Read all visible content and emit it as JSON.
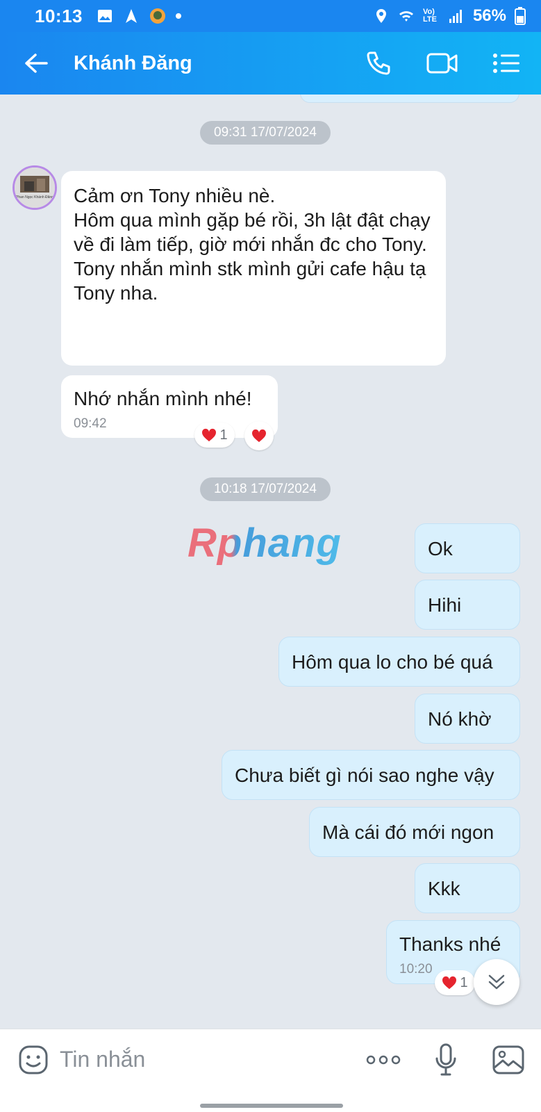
{
  "status_bar": {
    "time": "10:13",
    "battery": "56%",
    "lte_label": "Vo) LTE"
  },
  "header": {
    "title": "Khánh Đăng",
    "accent_color": "#1a86f0"
  },
  "chat": {
    "groups": [
      {
        "date_label": "09:31 17/07/2024",
        "sender": "contact",
        "avatar_caption": "Phan Ngọc Khánh Đăng",
        "messages": [
          {
            "text": "Cảm ơn Tony nhiều nè.\nHôm qua mình gặp bé rồi, 3h lật đật chạy về đi làm tiếp, giờ mới nhắn đc cho Tony.\nTony nhắn mình stk mình gửi cafe hậu tạ Tony nha.",
            "time": ""
          },
          {
            "text": "Nhớ nhắn mình nhé!",
            "time": "09:42",
            "reaction_count": "1"
          }
        ]
      },
      {
        "date_label": "10:18 17/07/2024",
        "sender": "me",
        "messages": [
          {
            "text": "Ok"
          },
          {
            "text": "Hihi"
          },
          {
            "text": "Hôm qua lo cho bé quá"
          },
          {
            "text": "Nó khờ"
          },
          {
            "text": "Chưa biết gì nói sao nghe vậy"
          },
          {
            "text": "Mà cái đó mới ngon"
          },
          {
            "text": "Kkk"
          },
          {
            "text": "Thanks nhé",
            "time": "10:20",
            "reaction_count": "1"
          }
        ]
      }
    ],
    "watermark": "Rphang"
  },
  "input_bar": {
    "placeholder": "Tin nhắn",
    "value": ""
  },
  "icons": {
    "back": "back-arrow-icon",
    "call": "phone-icon",
    "video": "video-camera-icon",
    "menu": "list-menu-icon",
    "emoji": "emoji-sticker-icon",
    "more": "more-dots-icon",
    "mic": "microphone-icon",
    "image": "image-gallery-icon",
    "scroll": "chevrons-down-icon",
    "heart": "heart-icon"
  }
}
